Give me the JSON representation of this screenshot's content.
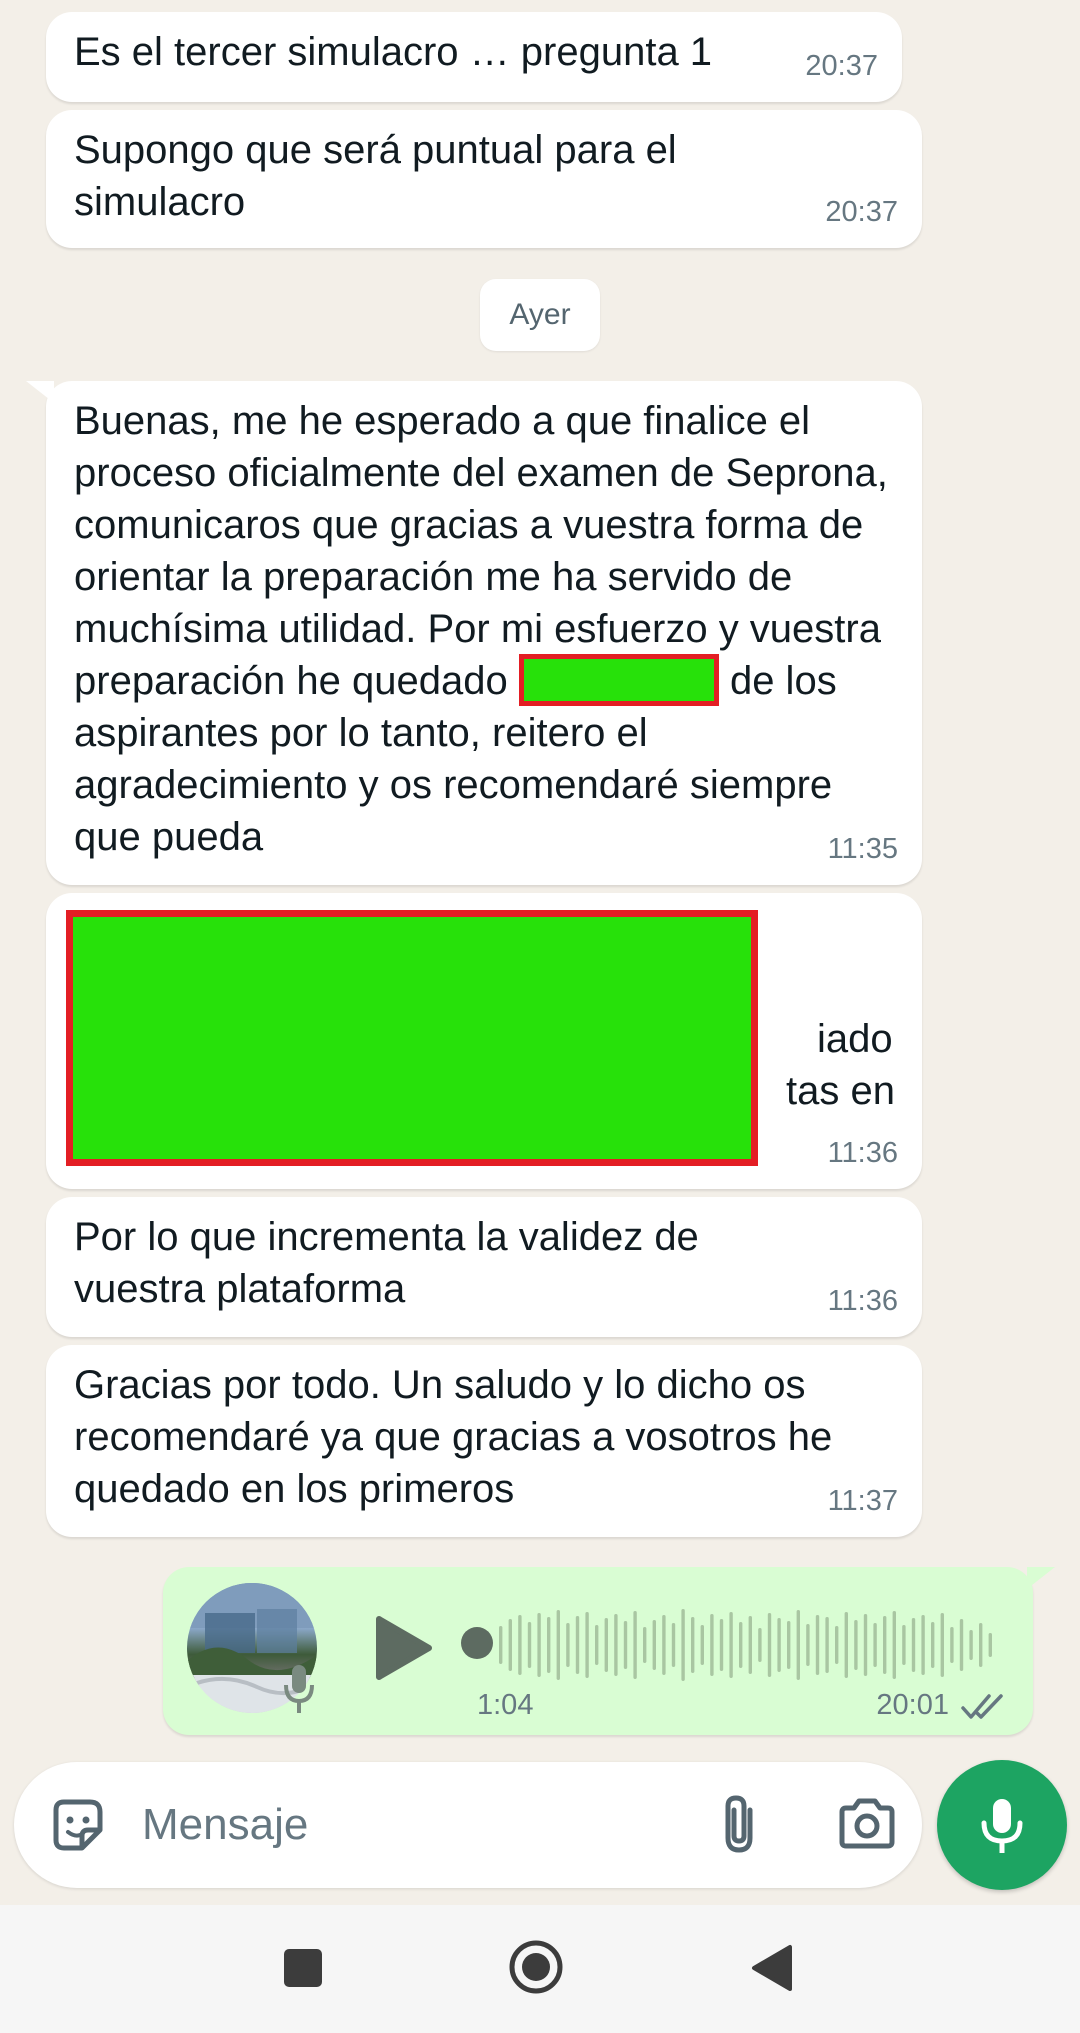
{
  "colors": {
    "chat_background": "#f3efe8",
    "incoming_bubble": "#ffffff",
    "outgoing_bubble": "#d9fdd3",
    "accent_green": "#1da462",
    "redaction_fill": "#27e10a",
    "redaction_border": "#e31e24"
  },
  "messages": [
    {
      "text": "Es el tercer simulacro … pregunta 1",
      "time": "20:37"
    },
    {
      "text": "Supongo que será puntual para el simulacro",
      "time": "20:37"
    },
    {
      "text_before": "Buenas, me he esperado a que finalice el proceso oficialmente del examen de Seprona, comunicaros que gracias a vuestra forma de orientar la preparación me ha servido de muchísima utilidad. Por mi esfuerzo y vuestra preparación he quedado",
      "text_after": "de los aspirantes por lo tanto, reitero el agradecimiento y os recomendaré siempre que pueda",
      "time": "11:35"
    },
    {
      "line1_fragment": "iado",
      "line2_fragment": "tas en",
      "time": "11:36"
    },
    {
      "text": "Por lo que incrementa la validez de vuestra plataforma",
      "time": "11:36"
    },
    {
      "text": "Gracias por todo. Un saludo y lo dicho os recomendaré ya que gracias a vosotros he quedado en los primeros",
      "time": "11:37"
    }
  ],
  "day_separator": "Ayer",
  "voice_message": {
    "duration": "1:04",
    "time": "20:01",
    "status_icon": "double-check-icon",
    "play_icon": "play-icon"
  },
  "composer": {
    "placeholder": "Mensaje",
    "icons": [
      "sticker-icon",
      "paperclip-icon",
      "camera-icon",
      "microphone-icon"
    ]
  },
  "navigation": {
    "buttons": [
      "recents-square-icon",
      "home-circle-icon",
      "back-triangle-icon"
    ]
  }
}
